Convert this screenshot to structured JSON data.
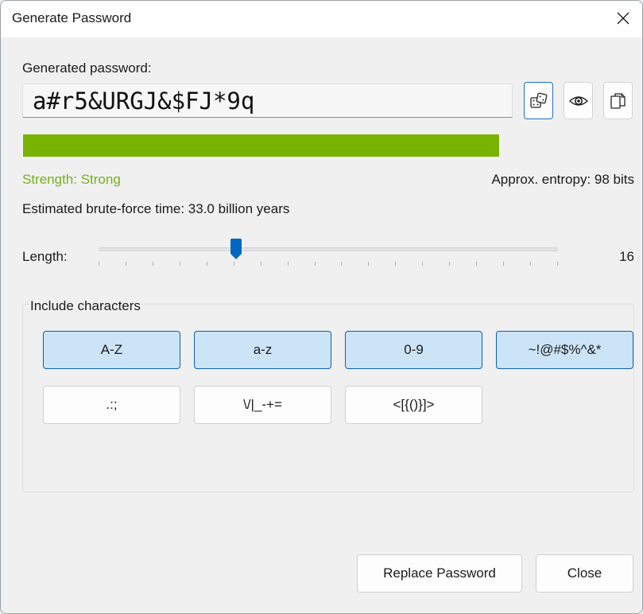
{
  "window": {
    "title": "Generate Password"
  },
  "icons": {
    "close": "close-icon",
    "generate": "dice-icon",
    "show": "eye-icon",
    "copy": "copy-icon"
  },
  "password": {
    "label": "Generated password:",
    "value": "a#r5&URGJ&$FJ*9q"
  },
  "strength": {
    "label": "Strength: Strong",
    "meter_fraction": 1.0,
    "color": "#77b300",
    "entropy": "Approx. entropy: 98 bits",
    "brute_force": "Estimated brute-force time: 33.0 billion years"
  },
  "length": {
    "label": "Length:",
    "value": "16",
    "slider_fraction": 0.3
  },
  "charset": {
    "title": "Include characters",
    "options": [
      {
        "label": "A-Z",
        "selected": true
      },
      {
        "label": "a-z",
        "selected": true
      },
      {
        "label": "0-9",
        "selected": true
      },
      {
        "label": "~!@#$%^&*",
        "selected": true
      },
      {
        "label": ".:;",
        "selected": false
      },
      {
        "label": "\\/|_-+=",
        "selected": false
      },
      {
        "label": "<[{()}]>",
        "selected": false
      }
    ]
  },
  "buttons": {
    "replace": "Replace Password",
    "close": "Close"
  },
  "colors": {
    "accent": "#0f5db5",
    "selected_bg": "#cce4f7",
    "strength_text": "#74b21e"
  }
}
